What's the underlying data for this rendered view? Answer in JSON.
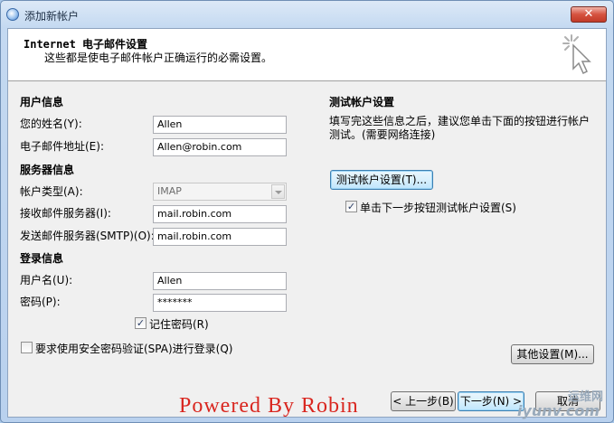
{
  "window": {
    "title": "添加新帐户",
    "close_symbol": "✕"
  },
  "header": {
    "title": "Internet 电子邮件设置",
    "subtitle": "这些都是使电子邮件帐户正确运行的必需设置。"
  },
  "user_info": {
    "section": "用户信息",
    "name_label": "您的姓名(Y):",
    "name_value": "Allen",
    "email_label": "电子邮件地址(E):",
    "email_value": "Allen@robin.com"
  },
  "server_info": {
    "section": "服务器信息",
    "type_label": "帐户类型(A):",
    "type_value": "IMAP",
    "incoming_label": "接收邮件服务器(I):",
    "incoming_value": "mail.robin.com",
    "outgoing_label": "发送邮件服务器(SMTP)(O):",
    "outgoing_value": "mail.robin.com"
  },
  "login_info": {
    "section": "登录信息",
    "username_label": "用户名(U):",
    "username_value": "Allen",
    "password_label": "密码(P):",
    "password_value": "*******",
    "remember_label": "记住密码(R)",
    "remember_checked": true,
    "spa_label": "要求使用安全密码验证(SPA)进行登录(Q)",
    "spa_checked": false
  },
  "test": {
    "section": "测试帐户设置",
    "description": "填写完这些信息之后，建议您单击下面的按钮进行帐户测试。(需要网络连接)",
    "button": "测试帐户设置(T)...",
    "auto_label": "单击下一步按钮测试帐户设置(S)",
    "auto_checked": true
  },
  "more_settings": "其他设置(M)...",
  "footer": {
    "back": "< 上一步(B)",
    "next": "下一步(N) >",
    "cancel": "取消"
  },
  "watermark": "Powered By Robin",
  "logo": {
    "top": "运维网",
    "bottom": "iyunv.com"
  }
}
